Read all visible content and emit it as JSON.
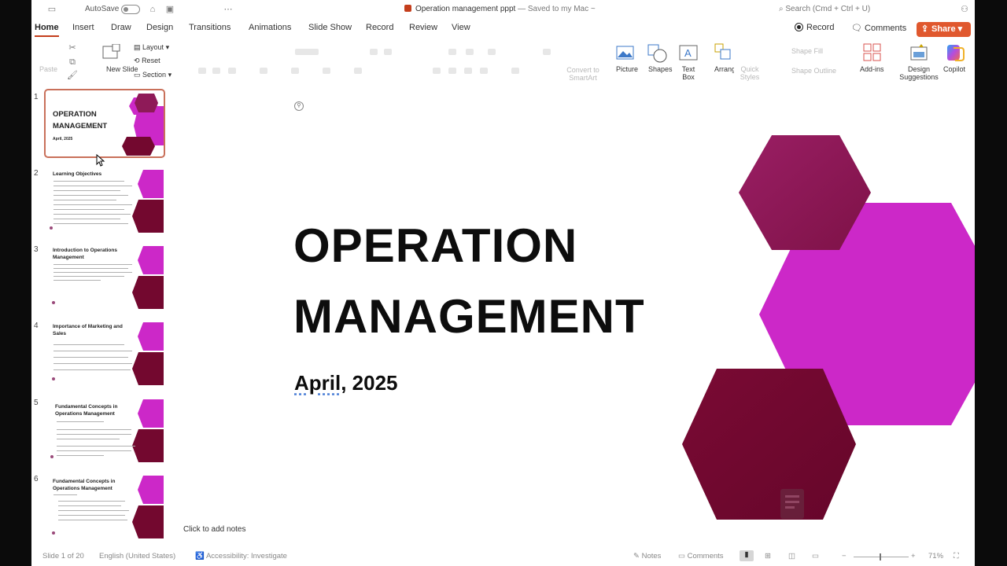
{
  "titlebar": {
    "autosave": "AutoSave",
    "doc_name": "Operation management pppt",
    "saved_status": "— Saved to my Mac ~",
    "search_placeholder": "Search (Cmd + Ctrl + U)"
  },
  "tabs": [
    "Home",
    "Insert",
    "Draw",
    "Design",
    "Transitions",
    "Animations",
    "Slide Show",
    "Record",
    "Review",
    "View"
  ],
  "active_tab": "Home",
  "actions": {
    "record": "Record",
    "comments": "Comments",
    "share": "Share"
  },
  "ribbon": {
    "paste": "Paste",
    "new_slide": "New Slide",
    "layout": "Layout",
    "reset": "Reset",
    "section": "Section",
    "convert_smartart": "Convert to SmartArt",
    "picture": "Picture",
    "shapes": "Shapes",
    "text_box": "Text Box",
    "arrange": "Arrange",
    "quick_styles": "Quick Styles",
    "shape_fill": "Shape Fill",
    "shape_outline": "Shape Outline",
    "add_ins": "Add-ins",
    "design_suggestions": "Design Suggestions",
    "copilot": "Copilot"
  },
  "thumbnails": [
    {
      "num": "1",
      "title": "OPERATION MANAGEMENT",
      "subtitle": "April, 2025"
    },
    {
      "num": "2",
      "title": "Learning Objectives"
    },
    {
      "num": "3",
      "title": "Introduction to Operations Management"
    },
    {
      "num": "4",
      "title": "Importance of Marketing and Sales"
    },
    {
      "num": "5",
      "title": "Fundamental Concepts in Operations Management"
    },
    {
      "num": "6",
      "title": "Fundamental Concepts in Operations Management"
    }
  ],
  "slide": {
    "title_line1": "OPERATION",
    "title_line2": "MANAGEMENT",
    "date_underlined": "April,",
    "date_rest": " 2025"
  },
  "notes_placeholder": "Click to add notes",
  "status": {
    "slide_info": "Slide 1 of 20",
    "language": "English (United States)",
    "accessibility": "Accessibility: Investigate",
    "notes": "Notes",
    "comments": "Comments",
    "zoom": "71%"
  },
  "colors": {
    "accent": "#c43e1c",
    "share_bg": "#e0582e",
    "hex_magenta": "#cc28c8",
    "hex_plum": "#8e1a58",
    "hex_burgundy": "#73082f"
  }
}
